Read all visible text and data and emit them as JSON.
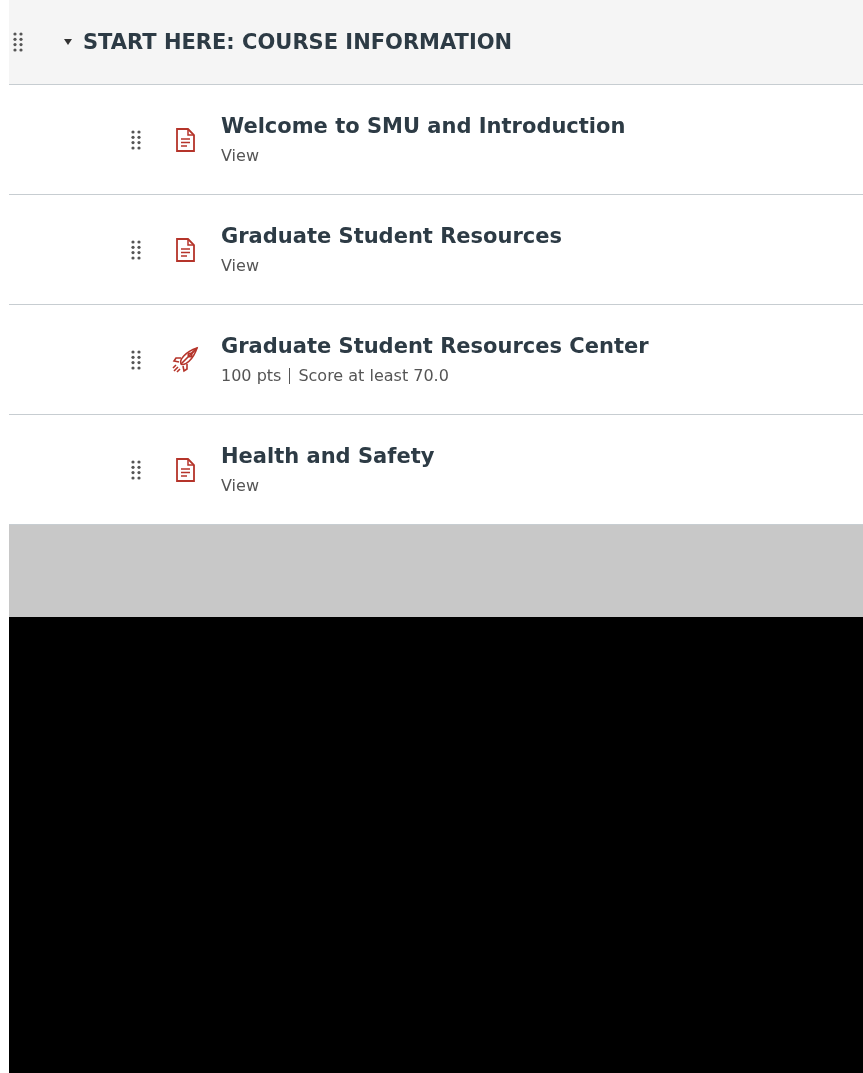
{
  "module": {
    "title": "START HERE: COURSE INFORMATION",
    "expanded": true,
    "items": [
      {
        "kind": "page",
        "title": "Welcome to SMU and Introduction",
        "details": [
          "View"
        ]
      },
      {
        "kind": "page",
        "title": "Graduate Student Resources",
        "details": [
          "View"
        ]
      },
      {
        "kind": "quiz",
        "title": "Graduate Student Resources Center",
        "details": [
          "100 pts",
          "Score at least 70.0"
        ]
      },
      {
        "kind": "page",
        "title": "Health and Safety",
        "details": [
          "View"
        ]
      }
    ]
  }
}
